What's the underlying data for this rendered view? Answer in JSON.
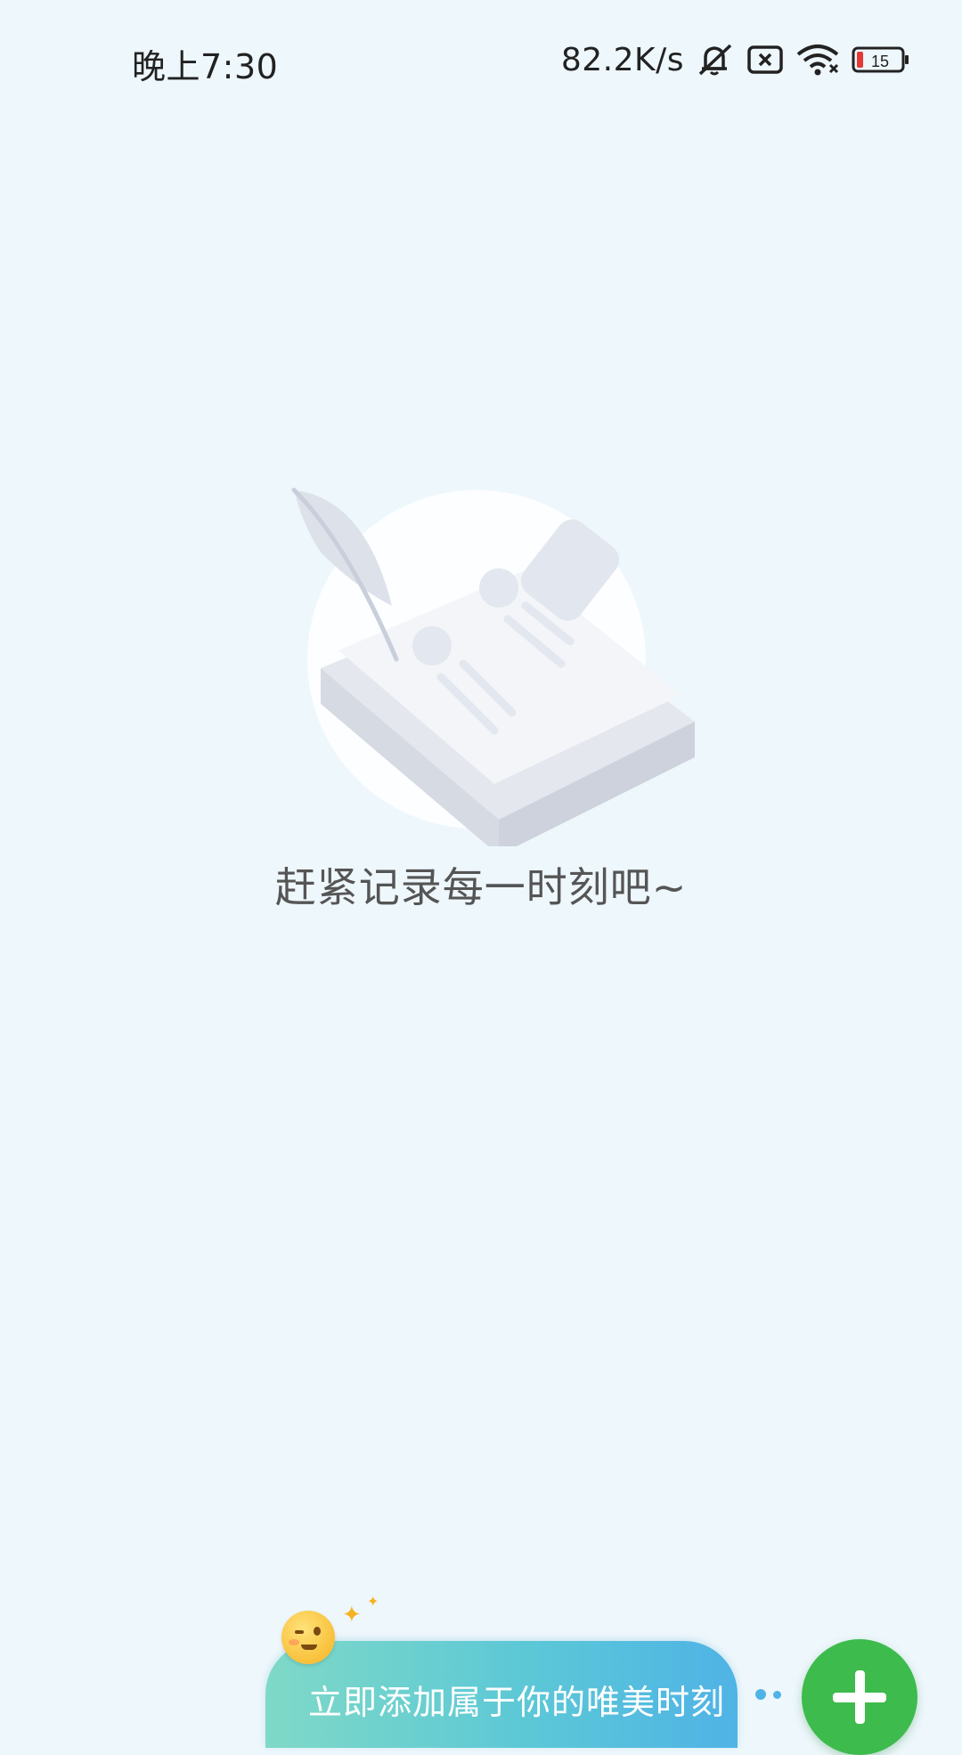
{
  "status_bar": {
    "time": "晚上7:30",
    "net_speed": "82.2K/s",
    "icons": [
      "mute-icon",
      "sim-off-icon",
      "wifi-icon",
      "battery-icon"
    ],
    "battery_level": "15",
    "battery_level_percent": 15,
    "battery_accent": "#e53935"
  },
  "empty_state": {
    "illustration": "empty-notebook-illustration",
    "message": "赶紧记录每一时刻吧~"
  },
  "bottom": {
    "emoji": "winking-face-emoji",
    "prompt_text": "立即添加属于你的唯美时刻",
    "add_button_icon": "plus-icon"
  },
  "colors": {
    "background": "#eef7fc",
    "accent_green": "#3dbb4d",
    "bubble_gradient_start": "#7fd9c7",
    "bubble_gradient_end": "#4fb3e6"
  }
}
